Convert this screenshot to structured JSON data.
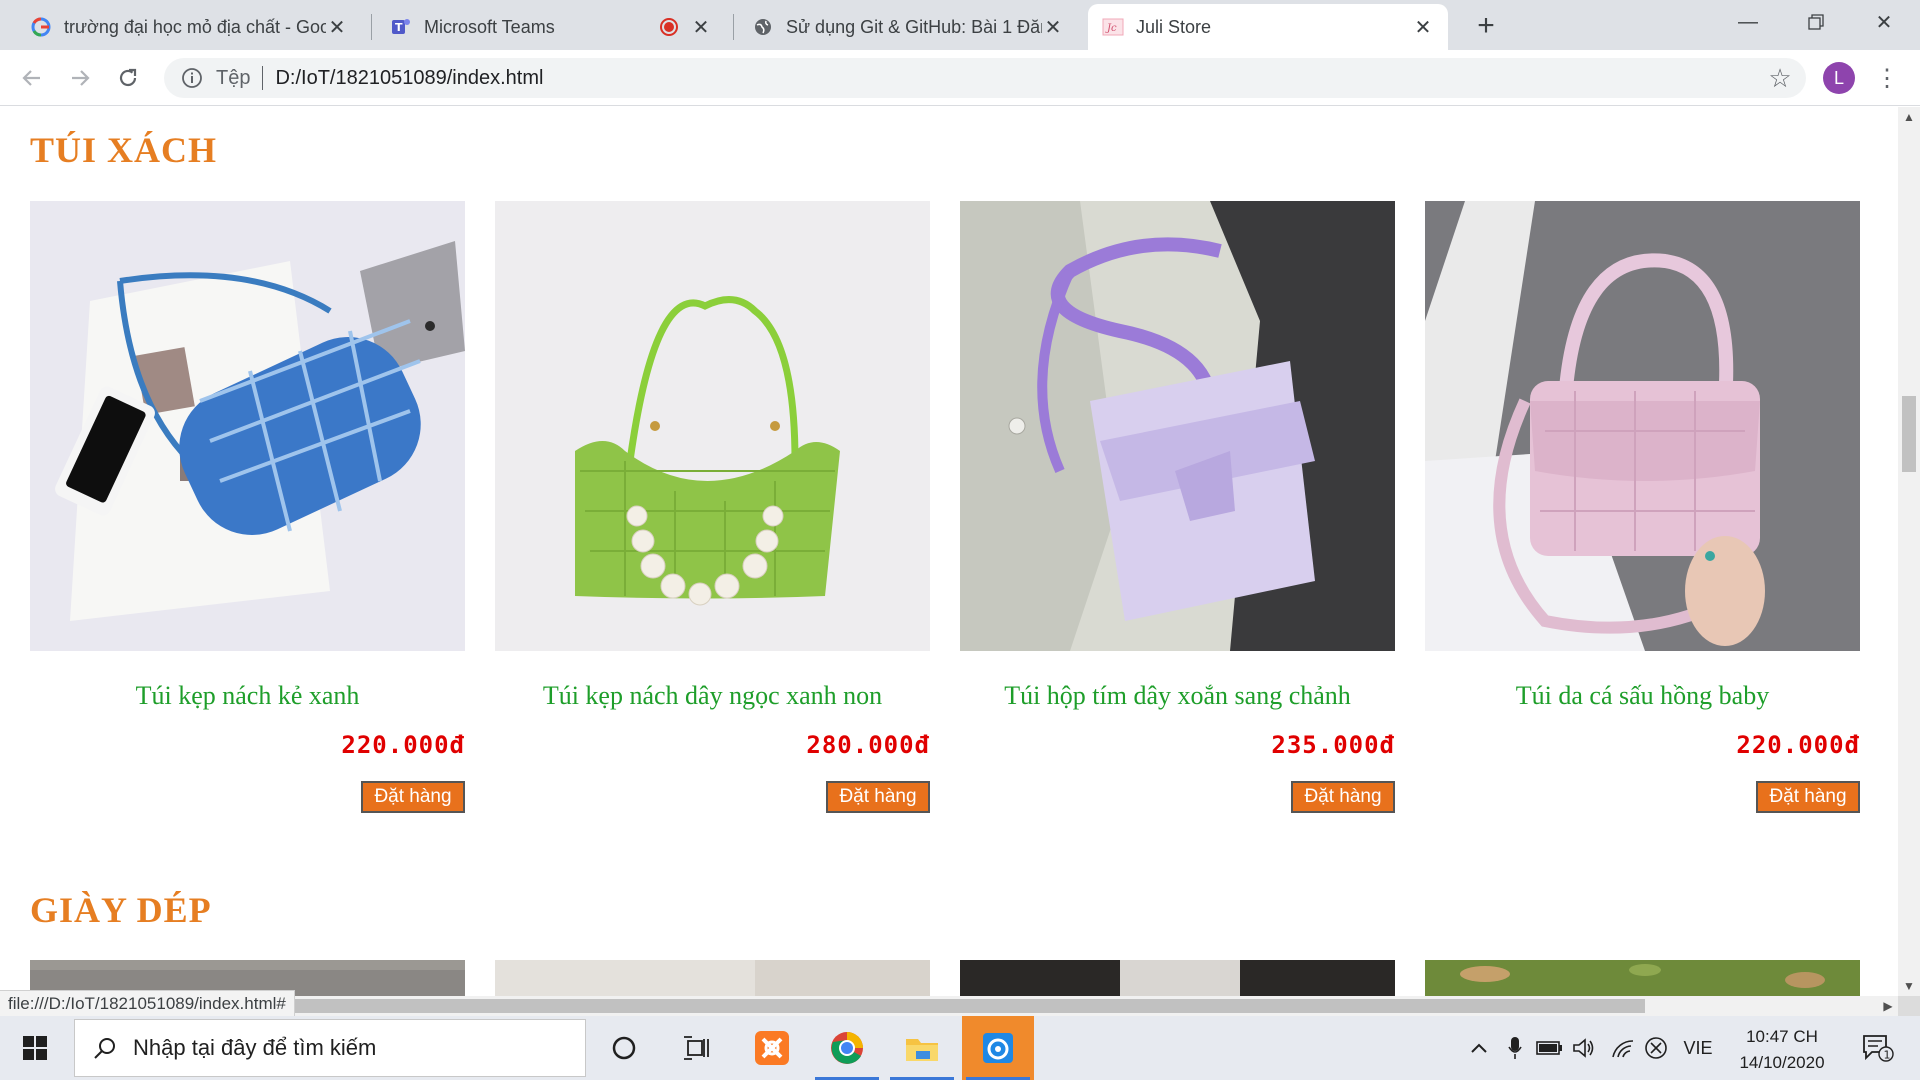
{
  "browser": {
    "tabs": [
      {
        "title": "trường đại học mỏ địa chất - Goo",
        "icon": "google-icon"
      },
      {
        "title": "Microsoft Teams",
        "icon": "teams-icon"
      },
      {
        "title": "Sử dụng Git & GitHub: Bài 1 Đăn",
        "icon": "globe-icon"
      },
      {
        "title": "Juli Store",
        "icon": "store-favicon"
      }
    ],
    "new_tab": "+",
    "omnibox": {
      "label": "Tệp",
      "url": "D:/IoT/1821051089/index.html"
    },
    "avatar_letter": "L",
    "status_url": "file:///D:/IoT/1821051089/index.html#"
  },
  "page": {
    "sections": [
      {
        "title": "TÚI XÁCH",
        "products": [
          {
            "name": "Túi kẹp nách kẻ xanh",
            "price": "220.000đ",
            "order_label": "Đặt hàng",
            "image": "blue-plaid-bag"
          },
          {
            "name": "Túi kẹp nách dây ngọc xanh non",
            "price": "280.000đ",
            "order_label": "Đặt hàng",
            "image": "green-pearl-bag"
          },
          {
            "name": "Túi hộp tím dây xoắn sang chảnh",
            "price": "235.000đ",
            "order_label": "Đặt hàng",
            "image": "purple-box-bag"
          },
          {
            "name": "Túi da cá sấu hồng baby",
            "price": "220.000đ",
            "order_label": "Đặt hàng",
            "image": "pink-croc-bag"
          }
        ]
      },
      {
        "title": "GIÀY DÉP",
        "products": [
          {
            "image": "shoe-photo-1"
          },
          {
            "image": "shoe-photo-2"
          },
          {
            "image": "shoe-photo-3"
          },
          {
            "image": "shoe-photo-4"
          }
        ]
      }
    ],
    "colors": {
      "section_title": "#e67e22",
      "product_name": "#1e9e2a",
      "price": "#e00000",
      "order_button": "#e8711c"
    }
  },
  "taskbar": {
    "search_placeholder": "Nhập tại đây để tìm kiếm",
    "language": "VIE",
    "time": "10:47 CH",
    "date": "14/10/2020",
    "notification_count": "1"
  }
}
